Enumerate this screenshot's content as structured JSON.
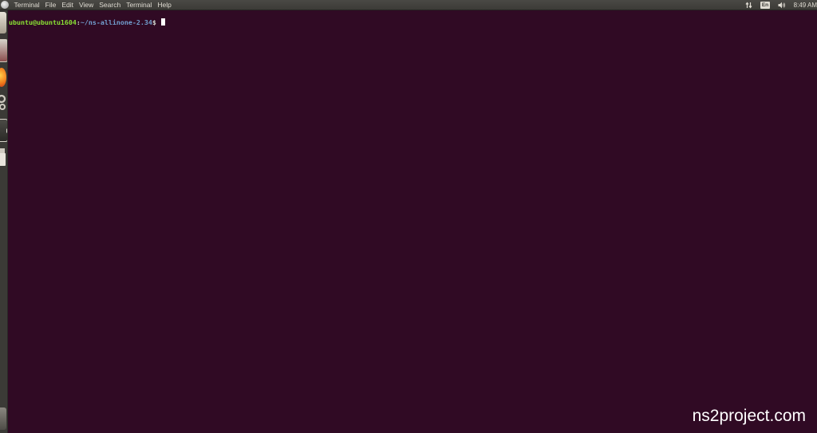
{
  "menu_bar": {
    "items": [
      "Terminal",
      "File",
      "Edit",
      "View",
      "Search",
      "Terminal",
      "Help"
    ]
  },
  "indicators": {
    "network_icon": "network-arrows-icon",
    "keyboard_layout": "En",
    "volume_icon": "speaker-icon",
    "clock": "8:49 AM"
  },
  "launcher": {
    "items": [
      "files-icon",
      "terminal-small-icon",
      "firefox-icon",
      "settings-icon",
      "terminal-icon",
      "usb-drive-icon",
      "trash-icon"
    ]
  },
  "terminal": {
    "prompt_user_host": "ubuntu@ubuntu1604",
    "prompt_separator": ":",
    "prompt_path": "~/ns-allinone-2.34",
    "prompt_symbol": "$ "
  },
  "watermark": {
    "text": "ns2project.com"
  },
  "colors": {
    "terminal_background": "#300a24",
    "prompt_user_color": "#8ae234",
    "prompt_path_color": "#729fcf",
    "panel_background": "#3c3b37",
    "panel_text": "#dfdbd2"
  }
}
